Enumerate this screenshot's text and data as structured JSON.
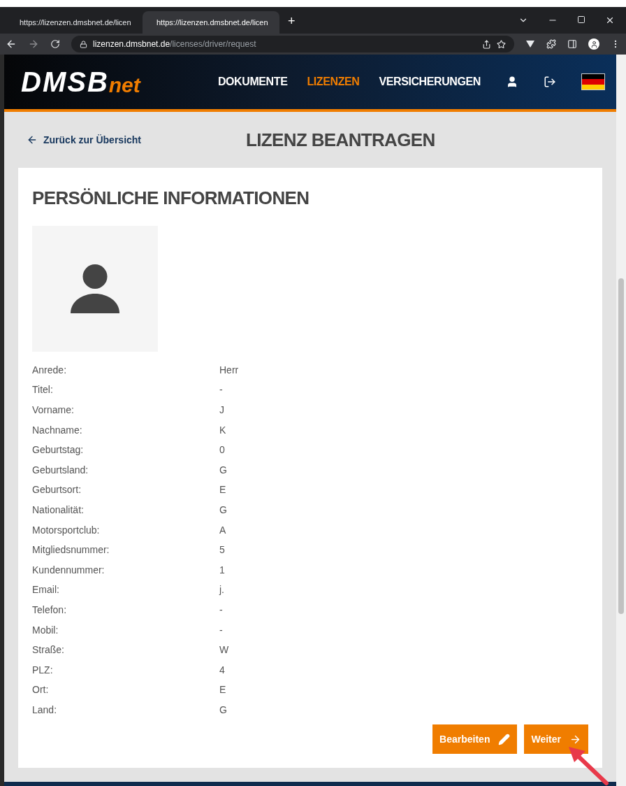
{
  "browser": {
    "tabs": [
      {
        "title": "https://lizenzen.dmsbnet.de/licen",
        "selected": false
      },
      {
        "title": "https://lizenzen.dmsbnet.de/licen",
        "selected": true
      }
    ],
    "new_tab": "+",
    "address": {
      "domain": "lizenzen.dmsbnet.de",
      "path": "/licenses/driver/request"
    }
  },
  "header": {
    "logo": {
      "main": "DMSB",
      "accent": "net"
    },
    "nav": [
      {
        "label": "DOKUMENTE",
        "selected": false
      },
      {
        "label": "LIZENZEN",
        "selected": true
      },
      {
        "label": "VERSICHERUNGEN",
        "selected": false
      }
    ]
  },
  "back_link": "Zurück zur Übersicht",
  "page_title": "LIZENZ BEANTRAGEN",
  "card": {
    "title": "PERSÖNLICHE INFORMATIONEN",
    "fields": [
      {
        "label": "Anrede:",
        "value": "Herr"
      },
      {
        "label": "Titel:",
        "value": "-"
      },
      {
        "label": "Vorname:",
        "value": "J"
      },
      {
        "label": "Nachname:",
        "value": "K"
      },
      {
        "label": "Geburtstag:",
        "value": "0"
      },
      {
        "label": "Geburtsland:",
        "value": "G"
      },
      {
        "label": "Geburtsort:",
        "value": "E"
      },
      {
        "label": "Nationalität:",
        "value": "G"
      },
      {
        "label": "Motorsportclub:",
        "value": "A"
      },
      {
        "label": "Mitgliedsnummer:",
        "value": "5"
      },
      {
        "label": "Kundennummer:",
        "value": "1"
      },
      {
        "label": "Email:",
        "value": "j."
      },
      {
        "label": "Telefon:",
        "value": "-"
      },
      {
        "label": "Mobil:",
        "value": "-"
      },
      {
        "label": "Straße:",
        "value": "W"
      },
      {
        "label": "PLZ:",
        "value": "4"
      },
      {
        "label": "Ort:",
        "value": "E"
      },
      {
        "label": "Land:",
        "value": "G"
      }
    ],
    "buttons": [
      {
        "label": "Bearbeiten",
        "kind": "edit"
      },
      {
        "label": "Weiter",
        "kind": "next"
      }
    ]
  }
}
